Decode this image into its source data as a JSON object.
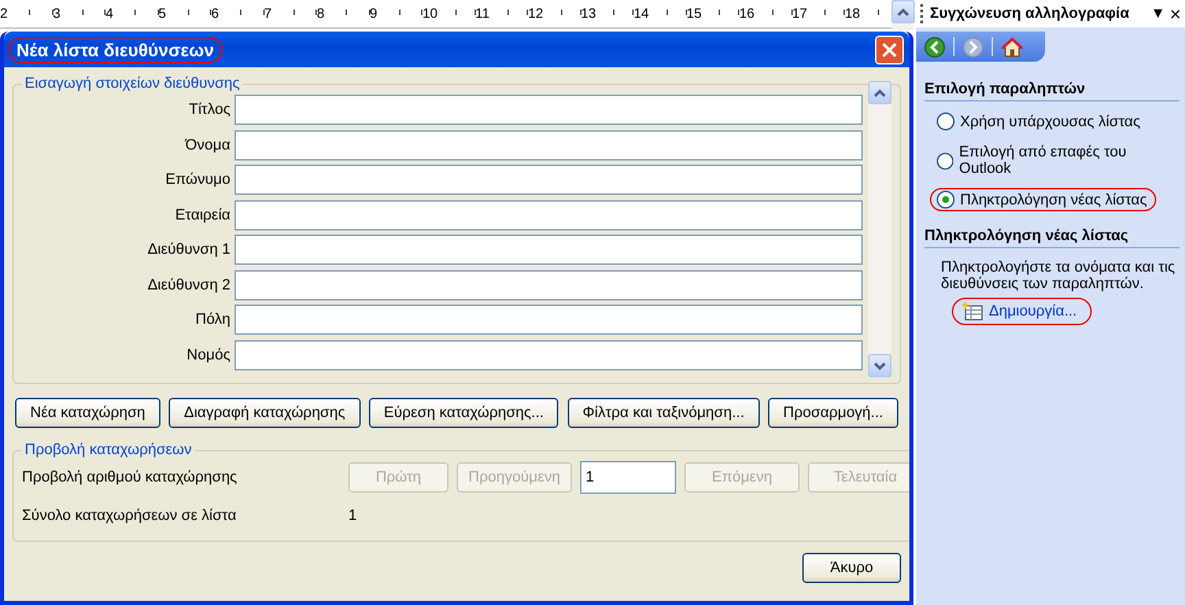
{
  "ruler": {
    "numbers": [
      "2",
      "3",
      "4",
      "5",
      "6",
      "7",
      "8",
      "9",
      "10",
      "11",
      "12",
      "13",
      "14",
      "15",
      "16",
      "17",
      "18"
    ]
  },
  "dialog": {
    "title": "Νέα λίστα διευθύνσεων",
    "title_highlighted": true,
    "entry_group": {
      "title": "Εισαγωγή στοιχείων διεύθυνσης",
      "fields": [
        {
          "label": "Τίτλος"
        },
        {
          "label": "Όνομα"
        },
        {
          "label": "Επώνυμο"
        },
        {
          "label": "Εταιρεία"
        },
        {
          "label": "Διεύθυνση 1"
        },
        {
          "label": "Διεύθυνση 2"
        },
        {
          "label": "Πόλη"
        },
        {
          "label": "Νομός"
        }
      ]
    },
    "buttons": [
      "Νέα καταχώρηση",
      "Διαγραφή καταχώρησης",
      "Εύρεση καταχώρησης...",
      "Φίλτρα και ταξινόμηση...",
      "Προσαρμογή..."
    ],
    "view_group": {
      "title": "Προβολή καταχωρήσεων",
      "entry_label": "Προβολή αριθμού καταχώρησης",
      "nav_buttons": [
        {
          "label": "Πρώτη",
          "disabled": true
        },
        {
          "label": "Προηγούμενη",
          "disabled": true
        }
      ],
      "entry_value": "1",
      "nav_buttons_after": [
        {
          "label": "Επόμενη",
          "disabled": true
        },
        {
          "label": "Τελευταία",
          "disabled": true
        }
      ],
      "total_label": "Σύνολο καταχωρήσεων σε λίστα",
      "total_value": "1"
    },
    "cancel": "Άκυρο"
  },
  "task_pane": {
    "title": "Συγχώνευση αλληλογραφία",
    "menu_glyph": "▼",
    "close_glyph": "×",
    "section_1": "Επιλογή παραληπτών",
    "options": [
      {
        "label": "Χρήση υπάρχουσας λίστας",
        "selected": false,
        "highlighted": false
      },
      {
        "label": "Επιλογή από επαφές του Outlook",
        "selected": false,
        "highlighted": false
      },
      {
        "label": "Πληκτρολόγηση νέας λίστας",
        "selected": true,
        "highlighted": true
      }
    ],
    "section_2": "Πληκτρολόγηση νέας λίστας",
    "description": "Πληκτρολογήστε τα ονόματα και τις διευθύνσεις των παραληπτών.",
    "create_link": {
      "label": "Δημιουργία...",
      "highlighted": true
    }
  }
}
